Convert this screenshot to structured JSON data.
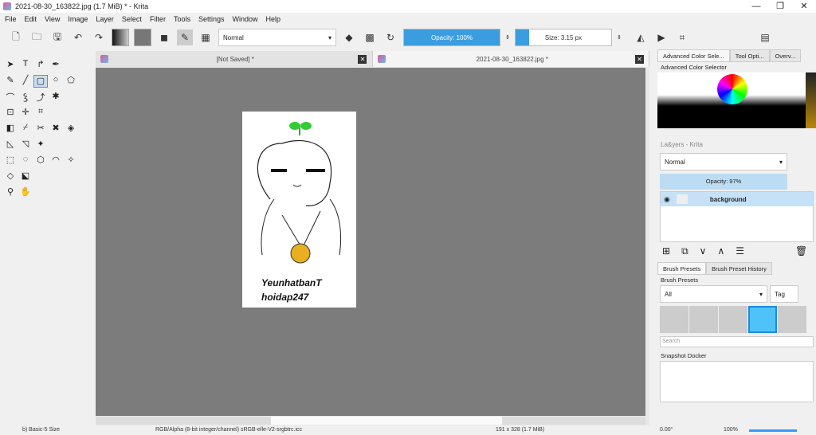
{
  "window": {
    "title": "2021-08-30_163822.jpg (1.7 MiB)  * - Krita",
    "min": "—",
    "max": "❐",
    "close": "✕"
  },
  "menu": [
    "File",
    "Edit",
    "View",
    "Image",
    "Layer",
    "Select",
    "Filter",
    "Tools",
    "Settings",
    "Window",
    "Help"
  ],
  "toolbar": {
    "blend_mode": "Normal",
    "opacity": "Opacity: 100%",
    "opacity_value": 100,
    "size": "Size: 3.15 px"
  },
  "tabs": [
    {
      "label": "[Not Saved]  *"
    },
    {
      "label": "2021-08-30_163822.jpg *"
    }
  ],
  "canvas": {
    "signature_line1": "YeunhatbanT",
    "signature_line2": "hoidap247"
  },
  "dockers": {
    "tabs": [
      "Advanced Color Sele...",
      "Tool Opti...",
      "Overv..."
    ],
    "color_selector_title": "Advanced Color Selector",
    "layers_title": "La&yers - Krita",
    "layers_blend": "Normal",
    "layers_opacity": "Opacity:  97%",
    "layers_opacity_value": 97,
    "layers": [
      {
        "name": "background"
      }
    ],
    "brush_tabs": [
      "Brush Presets",
      "Brush Preset History"
    ],
    "brush_title": "Brush Presets",
    "brush_filter": "All",
    "tag_label": "Tag",
    "search_placeholder": "Search",
    "snapshot_title": "Snapshot Docker"
  },
  "status": {
    "brush": "b) Basic-5 Size",
    "color_space": "RGB/Alpha (8-bit integer/channel)  sRGB-elle-V2-srgbtrc.icc",
    "dimensions": "191 x 328 (1.7 MiB)",
    "rotation": "0.00°",
    "zoom": "100%"
  }
}
